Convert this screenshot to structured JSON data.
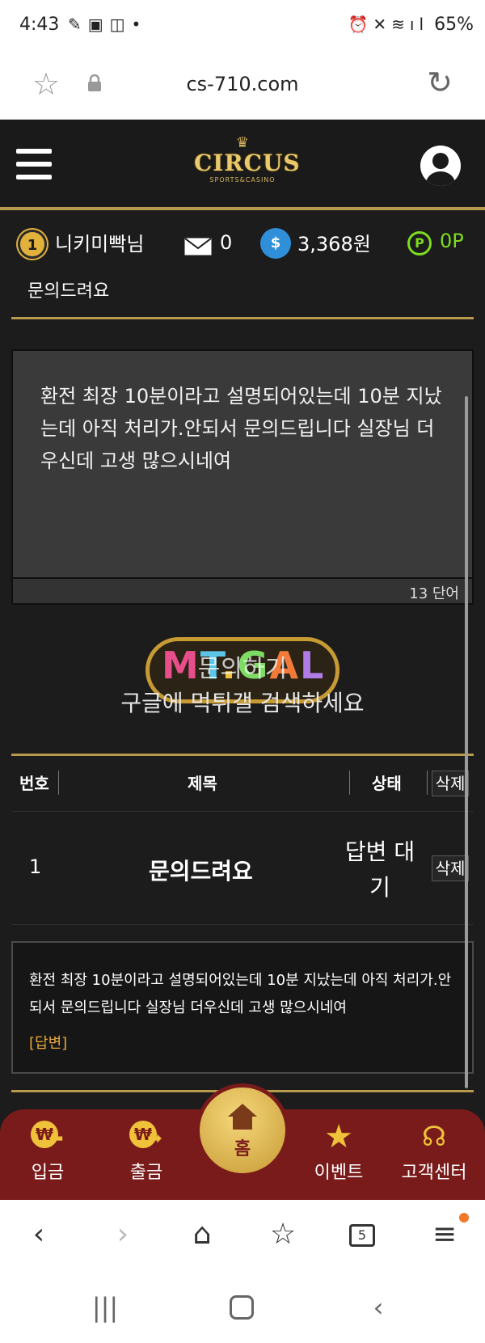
{
  "status_bar": {
    "time": "4:43",
    "battery": "65%",
    "left_icons": [
      "bandage-icon",
      "image-icon",
      "screenshot-icon",
      "dot-icon"
    ],
    "right_icons": [
      "alarm-icon",
      "mute-icon",
      "wifi-icon",
      "signal-icon"
    ]
  },
  "browser": {
    "url": "cs-710.com",
    "tab_count": "5"
  },
  "header": {
    "logo_text": "CIRCUS",
    "logo_sub": "SPORTS&CASINO"
  },
  "user": {
    "level": "1",
    "nickname": "니키미빡님",
    "mail_count": "0",
    "money": "3,368원",
    "points_icon": "P",
    "points": "0P"
  },
  "page": {
    "title": "문의드려요"
  },
  "message": {
    "body": "환전 최장 10분이라고 설명되어있는데 10분 지났는데 아직 처리가.안되서 문의드립니다 실장님 더우신데 고생 많으시네여",
    "count": "13 단어"
  },
  "watermark": {
    "logo_letters": [
      "M",
      "T",
      ".",
      "G",
      "A",
      "L"
    ],
    "overlay_text": "문의하기",
    "caption": "구글에 먹튀갤 검색하세요"
  },
  "table": {
    "headers": {
      "number": "번호",
      "subject": "제목",
      "status": "상태",
      "delete": "삭제"
    },
    "rows": [
      {
        "number": "1",
        "subject": "문의드려요",
        "status": "답변 대기",
        "delete": "삭제"
      }
    ]
  },
  "answer": {
    "text": "환전 최장 10분이라고 설명되어있는데 10분 지났는데 아직 처리가.안되서 문의드립니다 실장님 더우신데 고생 많으시네여",
    "reply_label": "[답변]"
  },
  "bottom_nav": {
    "deposit": "입금",
    "withdraw": "출금",
    "home": "홈",
    "event": "이벤트",
    "support": "고객센터"
  },
  "colors": {
    "gold": "#b89a4c",
    "nav_red": "#7a1b1b",
    "points_green": "#7ddc1e",
    "reply_orange": "#e8a83a"
  }
}
